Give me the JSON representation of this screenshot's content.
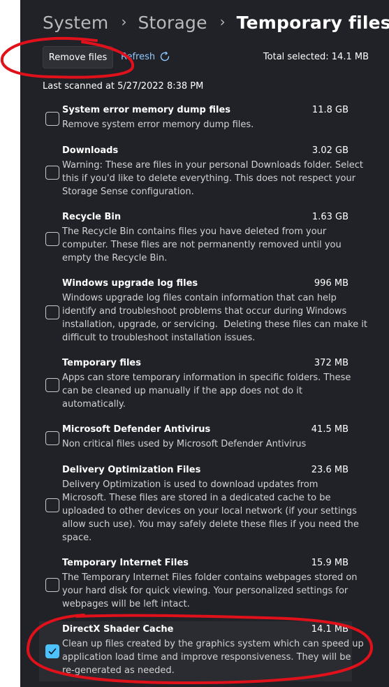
{
  "breadcrumb": [
    "System",
    "Storage",
    "Temporary files"
  ],
  "separator": "›",
  "toolbar": {
    "remove_label": "Remove files",
    "refresh_label": "Refresh",
    "total_selected": "Total selected: 14.1 MB"
  },
  "last_scanned": "Last scanned at 5/27/2022 8:38 PM",
  "items": [
    {
      "title": "System error memory dump files",
      "size": "11.8 GB",
      "checked": false,
      "lines": [
        "Remove system error memory dump files."
      ]
    },
    {
      "title": "Downloads",
      "size": "3.02 GB",
      "checked": false,
      "lines": [
        "Warning: These are files in your personal Downloads folder. Select",
        "this if you'd like to delete everything. This does not respect your",
        "Storage Sense configuration."
      ]
    },
    {
      "title": "Recycle Bin",
      "size": "1.63 GB",
      "checked": false,
      "lines": [
        "The Recycle Bin contains files you have deleted from your",
        "computer. These files are not permanently removed until you",
        "empty the Recycle Bin."
      ]
    },
    {
      "title": "Windows upgrade log files",
      "size": "996 MB",
      "checked": false,
      "lines": [
        "Windows upgrade log files contain information that can help",
        "identify and troubleshoot problems that occur during Windows",
        "installation, upgrade, or servicing.  Deleting these files can make it",
        "difficult to troubleshoot installation issues."
      ]
    },
    {
      "title": "Temporary files",
      "size": "372 MB",
      "checked": false,
      "lines": [
        "Apps can store temporary information in specific folders. These",
        "can be cleaned up manually if the app does not do it",
        "automatically."
      ]
    },
    {
      "title": "Microsoft Defender Antivirus",
      "size": "41.5 MB",
      "checked": false,
      "lines": [
        "Non critical files used by Microsoft Defender Antivirus"
      ]
    },
    {
      "title": "Delivery Optimization Files",
      "size": "23.6 MB",
      "checked": false,
      "lines": [
        "Delivery Optimization is used to download updates from",
        "Microsoft. These files are stored in a dedicated cache to be",
        "uploaded to other devices on your local network (if your settings",
        "allow such use). You may safely delete these files if you need the",
        "space."
      ]
    },
    {
      "title": "Temporary Internet Files",
      "size": "15.9 MB",
      "checked": false,
      "lines": [
        "The Temporary Internet Files folder contains webpages stored on",
        "your hard disk for quick viewing. Your personalized settings for",
        "webpages will be left intact."
      ]
    },
    {
      "title": "DirectX Shader Cache",
      "size": "14.1 MB",
      "checked": true,
      "lines": [
        "Clean up files created by the graphics system which can speed up",
        "application load time and improve responsiveness. They will be",
        "re-generated as needed."
      ]
    }
  ],
  "colors": {
    "window_bg": "#202228",
    "accent": "#4cc2ff",
    "link": "#8fc8ff",
    "annotation": "#e0111a"
  },
  "icons": [
    "refresh-icon",
    "checkmark-icon",
    "chevron-right-icon"
  ]
}
